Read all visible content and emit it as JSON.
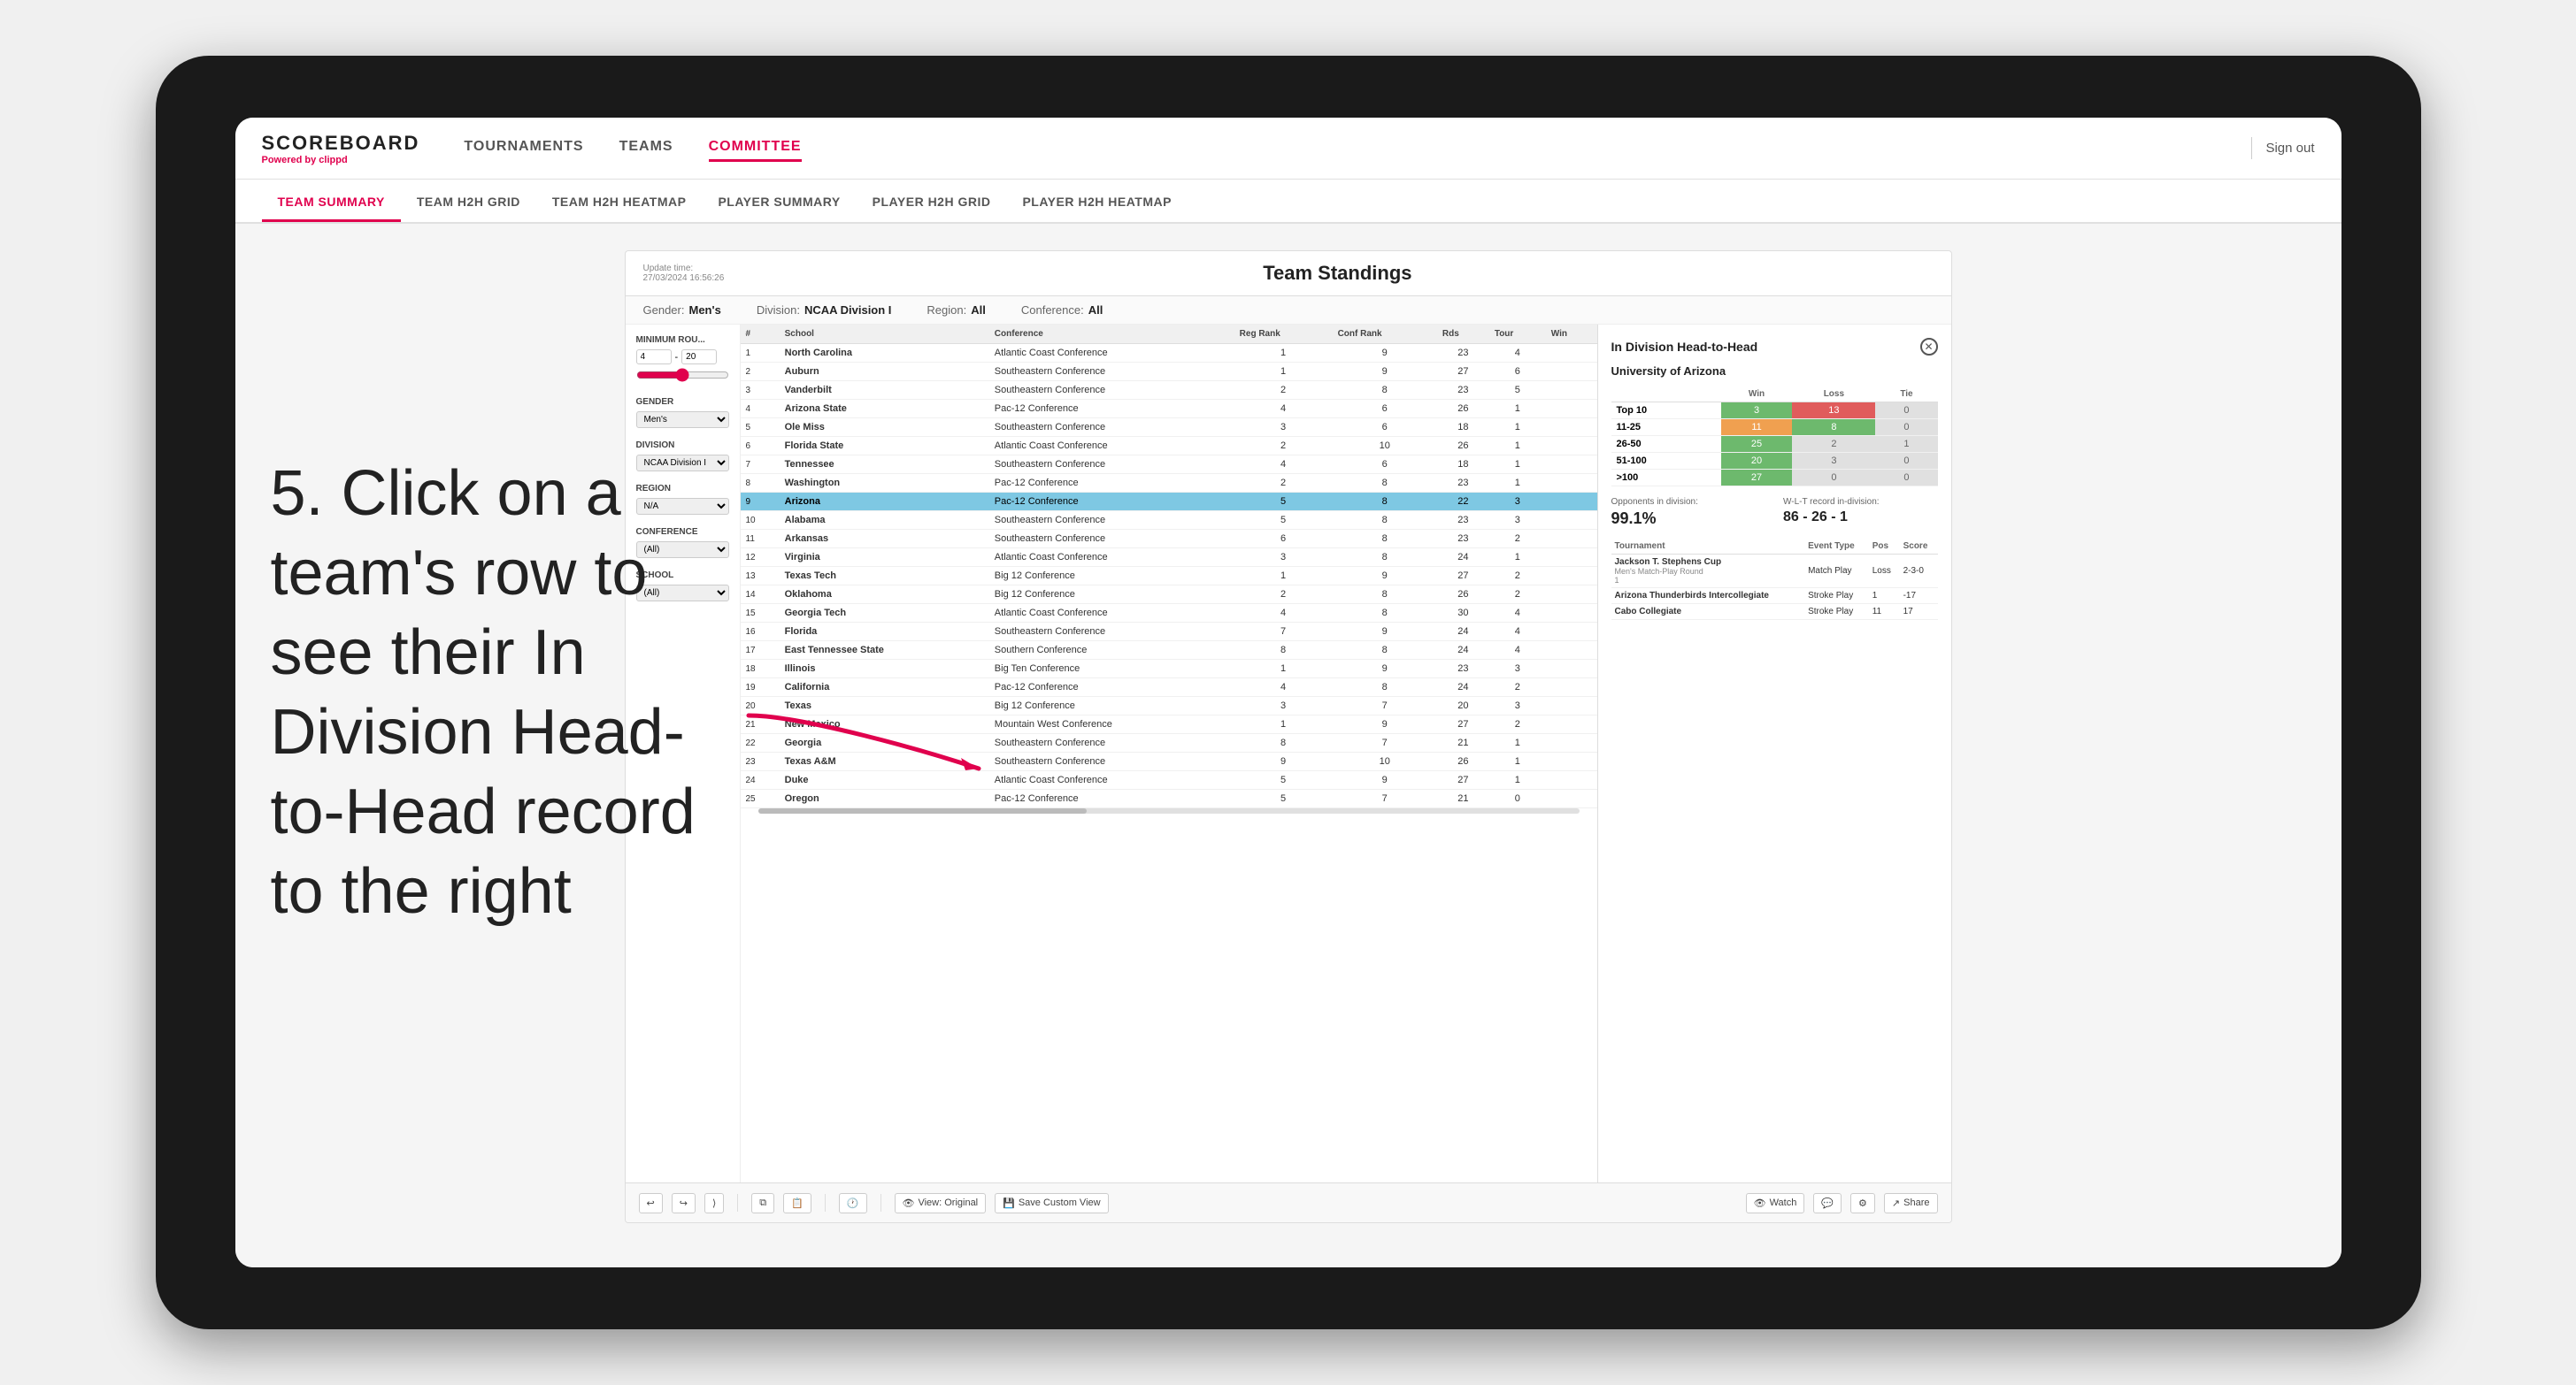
{
  "page": {
    "background": "#f0f0f0"
  },
  "instruction": {
    "text": "5. Click on a team's row to see their In Division Head-to-Head record to the right"
  },
  "header": {
    "logo_title": "SCOREBOARD",
    "logo_sub": "Powered by ",
    "logo_brand": "clippd",
    "sign_out": "Sign out",
    "nav": [
      {
        "label": "TOURNAMENTS",
        "active": false
      },
      {
        "label": "TEAMS",
        "active": false
      },
      {
        "label": "COMMITTEE",
        "active": true
      }
    ]
  },
  "sub_nav": [
    {
      "label": "TEAM SUMMARY",
      "active": true
    },
    {
      "label": "TEAM H2H GRID",
      "active": false
    },
    {
      "label": "TEAM H2H HEATMAP",
      "active": false
    },
    {
      "label": "PLAYER SUMMARY",
      "active": false
    },
    {
      "label": "PLAYER H2H GRID",
      "active": false
    },
    {
      "label": "PLAYER H2H HEATMAP",
      "active": false
    }
  ],
  "panel": {
    "update_time_label": "Update time:",
    "update_time_value": "27/03/2024 16:56:26",
    "title": "Team Standings",
    "filters": {
      "gender_label": "Gender:",
      "gender_value": "Men's",
      "division_label": "Division:",
      "division_value": "NCAA Division I",
      "region_label": "Region:",
      "region_value": "All",
      "conference_label": "Conference:",
      "conference_value": "All"
    }
  },
  "sidebar": {
    "min_rounds_label": "Minimum Rou...",
    "min_rounds_from": "4",
    "min_rounds_to": "20",
    "gender_label": "Gender",
    "gender_value": "Men's",
    "division_label": "Division",
    "division_value": "NCAA Division I",
    "region_label": "Region",
    "region_value": "N/A",
    "conference_label": "Conference",
    "conference_value": "(All)",
    "school_label": "School",
    "school_value": "(All)"
  },
  "table": {
    "headers": [
      "#",
      "School",
      "Conference",
      "Reg Rank",
      "Conf Rank",
      "Rds",
      "Tour",
      "Win"
    ],
    "rows": [
      {
        "rank": 1,
        "school": "North Carolina",
        "conference": "Atlantic Coast Conference",
        "reg_rank": 1,
        "conf_rank": 9,
        "rds": 23,
        "tour": 4,
        "win": "",
        "selected": false
      },
      {
        "rank": 2,
        "school": "Auburn",
        "conference": "Southeastern Conference",
        "reg_rank": 1,
        "conf_rank": 9,
        "rds": 27,
        "tour": 6,
        "win": "",
        "selected": false
      },
      {
        "rank": 3,
        "school": "Vanderbilt",
        "conference": "Southeastern Conference",
        "reg_rank": 2,
        "conf_rank": 8,
        "rds": 23,
        "tour": 5,
        "win": "",
        "selected": false
      },
      {
        "rank": 4,
        "school": "Arizona State",
        "conference": "Pac-12 Conference",
        "reg_rank": 4,
        "conf_rank": 6,
        "rds": 26,
        "tour": 1,
        "win": "",
        "selected": false
      },
      {
        "rank": 5,
        "school": "Ole Miss",
        "conference": "Southeastern Conference",
        "reg_rank": 3,
        "conf_rank": 6,
        "rds": 18,
        "tour": 1,
        "win": "",
        "selected": false
      },
      {
        "rank": 6,
        "school": "Florida State",
        "conference": "Atlantic Coast Conference",
        "reg_rank": 2,
        "conf_rank": 10,
        "rds": 26,
        "tour": 1,
        "win": "",
        "selected": false
      },
      {
        "rank": 7,
        "school": "Tennessee",
        "conference": "Southeastern Conference",
        "reg_rank": 4,
        "conf_rank": 6,
        "rds": 18,
        "tour": 1,
        "win": "",
        "selected": false
      },
      {
        "rank": 8,
        "school": "Washington",
        "conference": "Pac-12 Conference",
        "reg_rank": 2,
        "conf_rank": 8,
        "rds": 23,
        "tour": 1,
        "win": "",
        "selected": false
      },
      {
        "rank": 9,
        "school": "Arizona",
        "conference": "Pac-12 Conference",
        "reg_rank": 5,
        "conf_rank": 8,
        "rds": 22,
        "tour": 3,
        "win": "",
        "selected": true
      },
      {
        "rank": 10,
        "school": "Alabama",
        "conference": "Southeastern Conference",
        "reg_rank": 5,
        "conf_rank": 8,
        "rds": 23,
        "tour": 3,
        "win": "",
        "selected": false
      },
      {
        "rank": 11,
        "school": "Arkansas",
        "conference": "Southeastern Conference",
        "reg_rank": 6,
        "conf_rank": 8,
        "rds": 23,
        "tour": 2,
        "win": "",
        "selected": false
      },
      {
        "rank": 12,
        "school": "Virginia",
        "conference": "Atlantic Coast Conference",
        "reg_rank": 3,
        "conf_rank": 8,
        "rds": 24,
        "tour": 1,
        "win": "",
        "selected": false
      },
      {
        "rank": 13,
        "school": "Texas Tech",
        "conference": "Big 12 Conference",
        "reg_rank": 1,
        "conf_rank": 9,
        "rds": 27,
        "tour": 2,
        "win": "",
        "selected": false
      },
      {
        "rank": 14,
        "school": "Oklahoma",
        "conference": "Big 12 Conference",
        "reg_rank": 2,
        "conf_rank": 8,
        "rds": 26,
        "tour": 2,
        "win": "",
        "selected": false
      },
      {
        "rank": 15,
        "school": "Georgia Tech",
        "conference": "Atlantic Coast Conference",
        "reg_rank": 4,
        "conf_rank": 8,
        "rds": 30,
        "tour": 4,
        "win": "",
        "selected": false
      },
      {
        "rank": 16,
        "school": "Florida",
        "conference": "Southeastern Conference",
        "reg_rank": 7,
        "conf_rank": 9,
        "rds": 24,
        "tour": 4,
        "win": "",
        "selected": false
      },
      {
        "rank": 17,
        "school": "East Tennessee State",
        "conference": "Southern Conference",
        "reg_rank": 8,
        "conf_rank": 8,
        "rds": 24,
        "tour": 4,
        "win": "",
        "selected": false
      },
      {
        "rank": 18,
        "school": "Illinois",
        "conference": "Big Ten Conference",
        "reg_rank": 1,
        "conf_rank": 9,
        "rds": 23,
        "tour": 3,
        "win": "",
        "selected": false
      },
      {
        "rank": 19,
        "school": "California",
        "conference": "Pac-12 Conference",
        "reg_rank": 4,
        "conf_rank": 8,
        "rds": 24,
        "tour": 2,
        "win": "",
        "selected": false
      },
      {
        "rank": 20,
        "school": "Texas",
        "conference": "Big 12 Conference",
        "reg_rank": 3,
        "conf_rank": 7,
        "rds": 20,
        "tour": 3,
        "win": "",
        "selected": false
      },
      {
        "rank": 21,
        "school": "New Mexico",
        "conference": "Mountain West Conference",
        "reg_rank": 1,
        "conf_rank": 9,
        "rds": 27,
        "tour": 2,
        "win": "",
        "selected": false
      },
      {
        "rank": 22,
        "school": "Georgia",
        "conference": "Southeastern Conference",
        "reg_rank": 8,
        "conf_rank": 7,
        "rds": 21,
        "tour": 1,
        "win": "",
        "selected": false
      },
      {
        "rank": 23,
        "school": "Texas A&M",
        "conference": "Southeastern Conference",
        "reg_rank": 9,
        "conf_rank": 10,
        "rds": 26,
        "tour": 1,
        "win": "",
        "selected": false
      },
      {
        "rank": 24,
        "school": "Duke",
        "conference": "Atlantic Coast Conference",
        "reg_rank": 5,
        "conf_rank": 9,
        "rds": 27,
        "tour": 1,
        "win": "",
        "selected": false
      },
      {
        "rank": 25,
        "school": "Oregon",
        "conference": "Pac-12 Conference",
        "reg_rank": 5,
        "conf_rank": 7,
        "rds": 21,
        "tour": 0,
        "win": "",
        "selected": false
      }
    ]
  },
  "h2h": {
    "title": "In Division Head-to-Head",
    "team_name": "University of Arizona",
    "grid_headers": [
      "",
      "Win",
      "Loss",
      "Tie"
    ],
    "grid_rows": [
      {
        "label": "Top 10",
        "win": 3,
        "loss": 13,
        "tie": 0,
        "win_color": "green",
        "loss_color": "red",
        "tie_color": "gray"
      },
      {
        "label": "11-25",
        "win": 11,
        "loss": 8,
        "tie": 0,
        "win_color": "orange",
        "loss_color": "green",
        "tie_color": "gray"
      },
      {
        "label": "26-50",
        "win": 25,
        "loss": 2,
        "tie": 1,
        "win_color": "green",
        "loss_color": "gray",
        "tie_color": "gray"
      },
      {
        "label": "51-100",
        "win": 20,
        "loss": 3,
        "tie": 0,
        "win_color": "green",
        "loss_color": "gray",
        "tie_color": "gray"
      },
      {
        "label": ">100",
        "win": 27,
        "loss": 0,
        "tie": 0,
        "win_color": "green",
        "loss_color": "gray",
        "tie_color": "gray"
      }
    ],
    "opponents_label": "Opponents in division:",
    "opponents_value": "99.1%",
    "record_label": "W-L-T record in-division:",
    "record_value": "86 - 26 - 1",
    "tournaments_headers": [
      "Tournament",
      "Event Type",
      "Pos",
      "Score"
    ],
    "tournaments": [
      {
        "name": "Jackson T. Stephens Cup",
        "sub": "Men's Match-Play Round",
        "event_type": "Match Play",
        "pos": "Loss",
        "score": "2-3-0"
      },
      {
        "name": "",
        "sub": "1",
        "event_type": "",
        "pos": "",
        "score": ""
      },
      {
        "name": "Arizona Thunderbirds Intercollegiate",
        "sub": "",
        "event_type": "Stroke Play",
        "pos": "1",
        "score": "-17"
      },
      {
        "name": "Cabo Collegiate",
        "sub": "",
        "event_type": "Stroke Play",
        "pos": "11",
        "score": "17"
      }
    ]
  },
  "toolbar": {
    "undo": "↩",
    "redo": "↪",
    "forward": "⟩",
    "view_original": "View: Original",
    "save_custom": "Save Custom View",
    "watch": "Watch",
    "share": "Share"
  }
}
